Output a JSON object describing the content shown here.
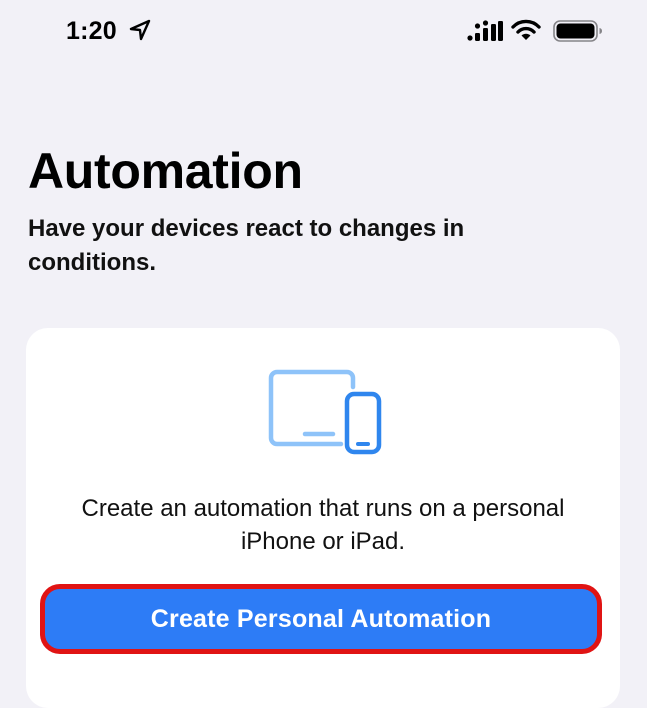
{
  "status_bar": {
    "time": "1:20",
    "icons": [
      "location-arrow-icon",
      "cellular-signal-icon",
      "wifi-icon",
      "battery-icon"
    ]
  },
  "header": {
    "title": "Automation",
    "subtitle": "Have your devices react to changes in conditions."
  },
  "card": {
    "illustration": "computer-and-phone-icon",
    "description": "Create an automation that runs on a personal iPhone or iPad.",
    "button_label": "Create Personal Automation"
  },
  "colors": {
    "background": "#f2f1f7",
    "card": "#ffffff",
    "accent": "#2d7cf6",
    "illustration_light": "#8ec3f9",
    "illustration_dark": "#2f86ee",
    "highlight_border": "#e01414"
  }
}
